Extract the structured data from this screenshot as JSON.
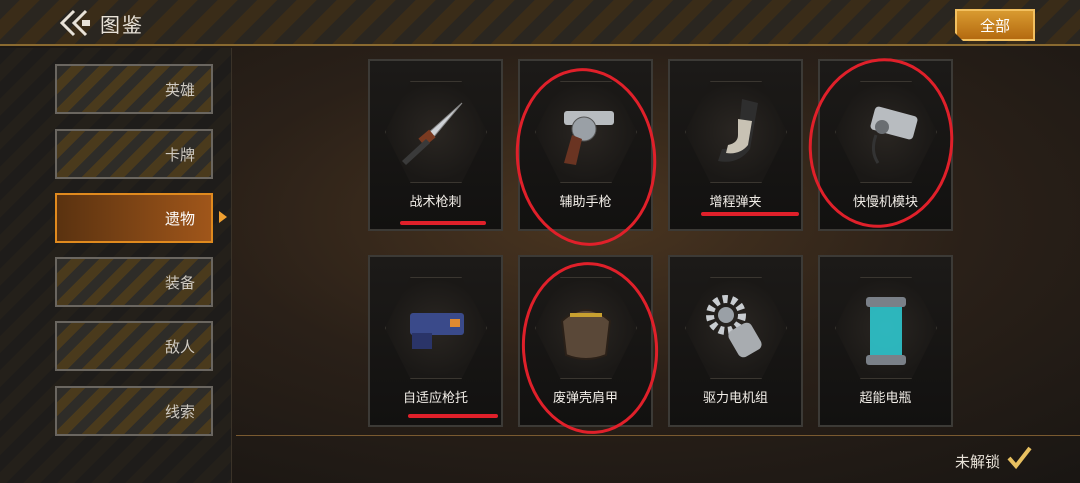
{
  "header": {
    "title": "图鉴",
    "filter_label": "全部"
  },
  "sidebar": {
    "items": [
      {
        "label": "英雄"
      },
      {
        "label": "卡牌"
      },
      {
        "label": "遗物",
        "active": true
      },
      {
        "label": "装备"
      },
      {
        "label": "敌人"
      },
      {
        "label": "线索"
      }
    ]
  },
  "relics": [
    {
      "name": "战术枪刺",
      "icon": "bayonet-knife-icon"
    },
    {
      "name": "辅助手枪",
      "icon": "revolver-icon"
    },
    {
      "name": "增程弹夹",
      "icon": "magazine-icon"
    },
    {
      "name": "快慢机模块",
      "icon": "fire-selector-module-icon"
    },
    {
      "name": "自适应枪托",
      "icon": "gun-stock-icon"
    },
    {
      "name": "废弹壳肩甲",
      "icon": "shell-pauldron-icon"
    },
    {
      "name": "驱力电机组",
      "icon": "motor-gear-icon"
    },
    {
      "name": "超能电瓶",
      "icon": "energy-battery-icon"
    }
  ],
  "footer": {
    "locked_label": "未解锁"
  },
  "colors": {
    "accent": "#e08a1e",
    "annotation_red": "#e0202a"
  }
}
